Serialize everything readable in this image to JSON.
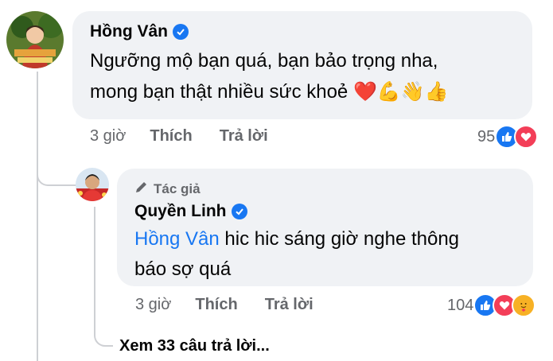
{
  "comment1": {
    "author": "Hồng Vân",
    "text_line1": "Ngưỡng mộ bạn quá, bạn bảo trọng nha,",
    "text_line2": "mong bạn thật nhiều sức khoẻ",
    "emojis": "❤️💪👋👍",
    "time": "3 giờ",
    "like_label": "Thích",
    "reply_label": "Trả lời",
    "reaction_count": "95",
    "reaction_icons": [
      "like-icon",
      "love-icon"
    ]
  },
  "reply1": {
    "author_badge": "Tác giả",
    "author": "Quyền Linh",
    "mention": "Hồng Vân",
    "text_line1": " hic hic sáng giờ nghe thông",
    "text_line2": "báo sợ quá",
    "time": "3 giờ",
    "like_label": "Thích",
    "reply_label": "Trả lời",
    "reaction_count": "104",
    "reaction_icons": [
      "like-icon",
      "love-icon",
      "care-icon"
    ]
  },
  "view_more_replies": "Xem 33 câu trả lời...",
  "colors": {
    "accent": "#1877f2",
    "love": "#f33e58",
    "care": "#f7b125",
    "bubble": "#f0f2f5",
    "meta_text": "#65676b"
  }
}
